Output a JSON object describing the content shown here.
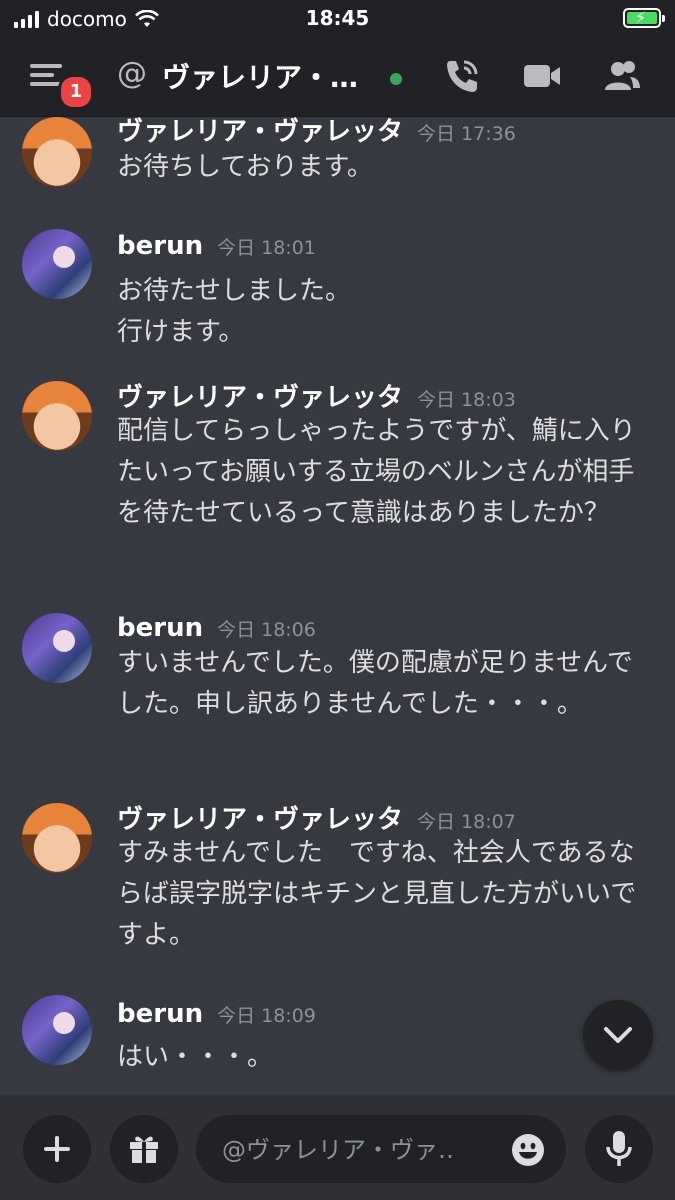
{
  "status_bar": {
    "carrier": "docomo",
    "time": "18:45",
    "icons": [
      "signal-icon",
      "wifi-icon",
      "battery-charging-icon"
    ]
  },
  "header": {
    "unread_count": "1",
    "at_symbol": "@",
    "title": "ヴァレリア・…",
    "status": "online",
    "icons": [
      "menu-icon",
      "call-icon",
      "video-icon",
      "members-icon"
    ]
  },
  "messages": [
    {
      "author": "ヴァレリア・ヴァレッタ",
      "time": "今日 17:36",
      "text": "お待ちしております。"
    },
    {
      "author": "berun",
      "time": "今日 18:01",
      "text": "お待たせしました。\n行けます。"
    },
    {
      "author": "ヴァレリア・ヴァレッタ",
      "time": "今日 18:03",
      "text": "配信してらっしゃったようですが、鯖に入りたいってお願いする立場のベルンさんが相手を待たせているって意識はありましたか？"
    },
    {
      "author": "berun",
      "time": "今日 18:06",
      "text": "すいませんでした。僕の配慮が足りませんでした。申し訳ありませんでした・・・。"
    },
    {
      "author": "ヴァレリア・ヴァレッタ",
      "time": "今日 18:07",
      "text": "すみませんでした　ですね、社会人であるならば誤字脱字はキチンと見直した方がいいですよ。"
    },
    {
      "author": "berun",
      "time": "今日 18:09",
      "text": "はい・・・。"
    }
  ],
  "composer": {
    "placeholder": "@ヴァレリア・ヴァ‥",
    "icons": [
      "plus-icon",
      "gift-icon",
      "emoji-icon",
      "microphone-icon"
    ]
  },
  "colors": {
    "background": "#36393f",
    "header": "#202225",
    "online": "#3ba55d",
    "badge": "#ed4245"
  }
}
